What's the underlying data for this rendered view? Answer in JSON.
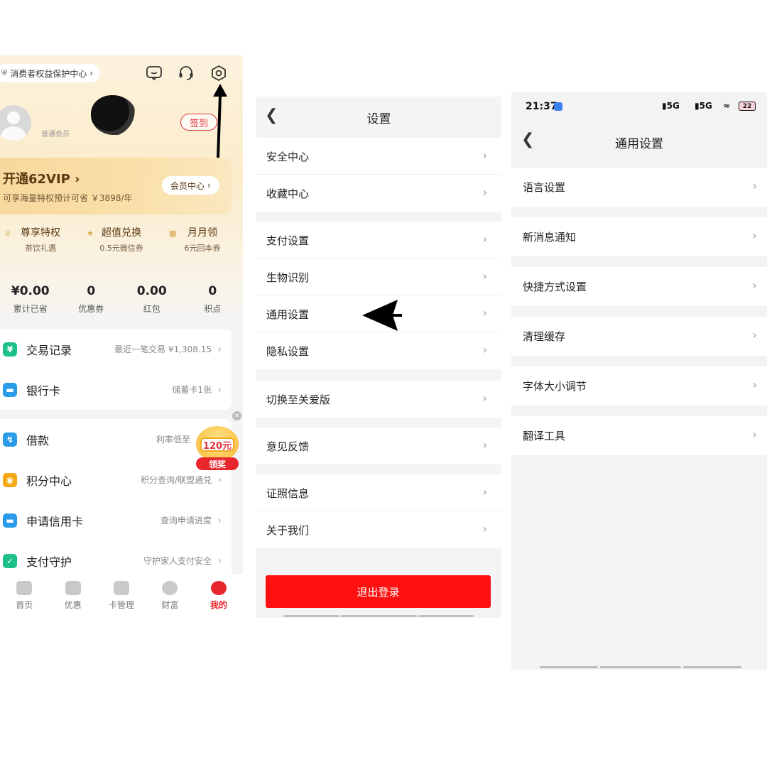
{
  "panel1": {
    "consumer_center": "消费者权益保护中心",
    "username": "",
    "user_level": "普通会员",
    "checkin": "签到",
    "vip": {
      "title": "开通62VIP",
      "subtitle": "可享海量特权预计可省 ￥3898/年",
      "member_center": "会员中心"
    },
    "perks": [
      {
        "title": "尊享特权",
        "sub": "茶饮礼遇"
      },
      {
        "title": "超值兑换",
        "sub": "0.5元微信券"
      },
      {
        "title": "月月领",
        "sub": "6元回本券"
      }
    ],
    "stats": [
      {
        "value": "¥0.00",
        "label": "累计已省"
      },
      {
        "value": "0",
        "label": "优惠券"
      },
      {
        "value": "0.00",
        "label": "红包"
      },
      {
        "value": "0",
        "label": "积点"
      }
    ],
    "list_a": [
      {
        "label": "交易记录",
        "note": "最近一笔交易 ¥1,308.15",
        "icon_color": "#1cc089",
        "icon": "yuan-icon"
      },
      {
        "label": "银行卡",
        "note": "储蓄卡1张",
        "icon_color": "#2a9be8",
        "icon": "card-icon"
      }
    ],
    "list_b": [
      {
        "label": "借款",
        "note": "利率低至",
        "icon_color": "#2a9be8",
        "icon": "loan-icon"
      },
      {
        "label": "积分中心",
        "note": "积分查询/联盟通兑",
        "icon_color": "#f3a712",
        "icon": "points-icon"
      },
      {
        "label": "申请信用卡",
        "note": "查询申请进度",
        "icon_color": "#2a9be8",
        "icon": "credit-card-icon"
      },
      {
        "label": "支付守护",
        "note": "守护家人支付安全",
        "icon_color": "#1cc089",
        "icon": "shield-check-icon"
      }
    ],
    "reward": {
      "amount": "120元",
      "claim": "领奖"
    },
    "tabs": [
      {
        "label": "首页",
        "active": false
      },
      {
        "label": "优惠",
        "active": false
      },
      {
        "label": "卡管理",
        "active": false
      },
      {
        "label": "财富",
        "active": false
      },
      {
        "label": "我的",
        "active": true
      }
    ]
  },
  "panel2": {
    "title": "设置",
    "groups": [
      [
        "安全中心",
        "收藏中心"
      ],
      [
        "支付设置",
        "生物识别",
        "通用设置",
        "隐私设置"
      ],
      [
        "切换至关爱版"
      ],
      [
        "意见反馈"
      ],
      [
        "证照信息",
        "关于我们"
      ]
    ],
    "logout": "退出登录"
  },
  "panel3": {
    "status": {
      "time": "21:37",
      "sig1": "5G",
      "sig2": "5G",
      "battery": "22"
    },
    "title": "通用设置",
    "items": [
      "语言设置",
      "新消息通知",
      "快捷方式设置",
      "清理缓存",
      "字体大小调节",
      "翻译工具"
    ]
  },
  "colors": {
    "accent_red": "#ff1010",
    "brand_red": "#e8262e",
    "gold_text": "#5a3a12"
  }
}
